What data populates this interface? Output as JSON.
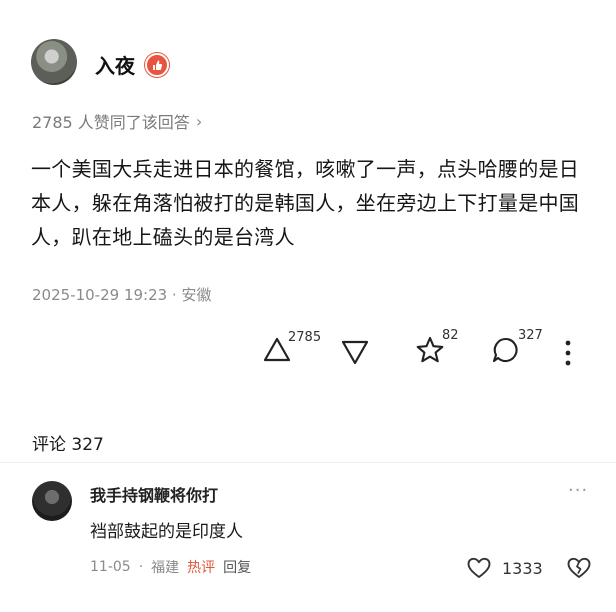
{
  "author": {
    "name": "入夜"
  },
  "answer": {
    "likes_summary": "2785 人赞同了该回答",
    "content": "一个美国大兵走进日本的餐馆，咳嗽了一声，点头哈腰的是日本人，躲在角落怕被打的是韩国人，坐在旁边上下打量是中国人，趴在地上磕头的是台湾人",
    "timestamp_location": "2025-10-29 19:23 · 安徽"
  },
  "actions": {
    "upvote_count": "2785",
    "favorite_count": "82",
    "comment_count": "327"
  },
  "comments": {
    "title": "评论 327",
    "items": [
      {
        "user": "我手持钢鞭将你打",
        "text": "裆部鼓起的是印度人",
        "date": "11-05",
        "location": "福建",
        "tag": "热评",
        "reply_label": "回复",
        "like_count": "1333"
      }
    ]
  },
  "icons": {
    "upvote": "triangle-up-icon",
    "downvote": "triangle-down-icon",
    "favorite": "star-icon",
    "comment": "speech-bubble-icon",
    "more": "more-vertical-icon",
    "heart": "heart-icon",
    "broken_heart": "broken-heart-icon"
  },
  "colors": {
    "accent_red": "#e8553f",
    "muted_text": "#8a8a8a"
  }
}
